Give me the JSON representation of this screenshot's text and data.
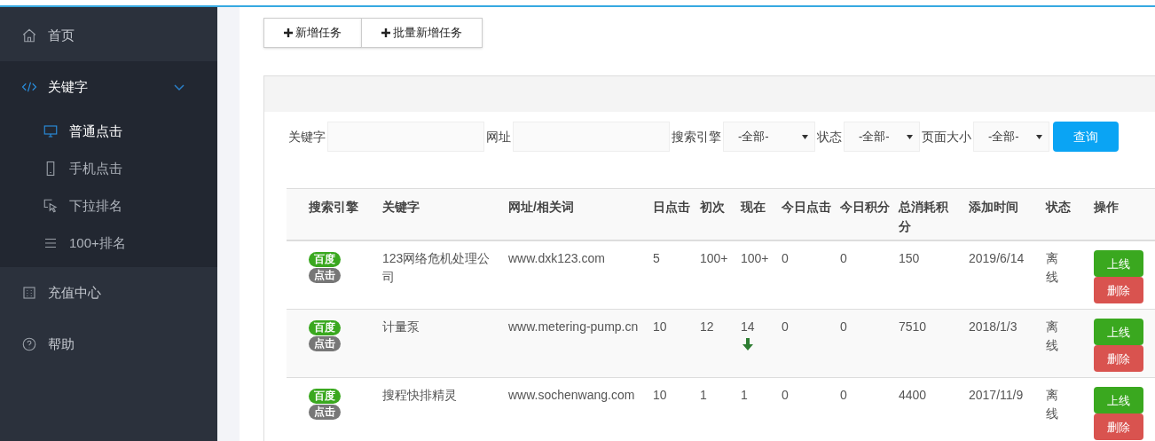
{
  "sidebar": {
    "items": [
      {
        "label": "首页",
        "selected": false,
        "expanded": false
      },
      {
        "label": "关键字",
        "selected": false,
        "expanded": true,
        "children": [
          {
            "label": "普通点击",
            "selected": true
          },
          {
            "label": "手机点击",
            "selected": false
          },
          {
            "label": "下拉排名",
            "selected": false
          },
          {
            "label": "100+排名",
            "selected": false
          }
        ]
      },
      {
        "label": "充值中心",
        "selected": false,
        "expanded": false
      },
      {
        "label": "帮助",
        "selected": false,
        "expanded": false
      }
    ]
  },
  "toolbar": {
    "buttons": [
      "新增任务",
      "批量新增任务"
    ]
  },
  "filters": {
    "fields": [
      {
        "kind": "input",
        "label": "关键字"
      },
      {
        "kind": "input",
        "label": "网址"
      },
      {
        "kind": "select",
        "label": "搜索引擎",
        "value": "-全部-"
      },
      {
        "kind": "select",
        "label": "状态",
        "value": "-全部-"
      },
      {
        "kind": "select",
        "label": "页面大小",
        "value": "-全部-"
      }
    ],
    "submit": "查询"
  },
  "table": {
    "columns": [
      "搜索引擎",
      "关键字",
      "网址/相关词",
      "日点击",
      "初次",
      "现在",
      "今日点击",
      "今日积分",
      "总消耗积分",
      "添加时间",
      "状态",
      "操作"
    ],
    "rows": [
      {
        "engine": "百度",
        "type": "点击",
        "keyword": "123网络危机处理公司",
        "url": "www.dxk123.com",
        "daily": "5",
        "first": "100+",
        "now": "100+",
        "falling": false,
        "today_clicks": "0",
        "today_points": "0",
        "total_points": "150",
        "added": "2019/6/14",
        "status": "离线",
        "actions": [
          "上线",
          "删除"
        ]
      },
      {
        "engine": "百度",
        "type": "点击",
        "keyword": "计量泵",
        "url": "www.metering-pump.cn",
        "daily": "10",
        "first": "12",
        "now": "14",
        "falling": true,
        "today_clicks": "0",
        "today_points": "0",
        "total_points": "7510",
        "added": "2018/1/3",
        "status": "离线",
        "actions": [
          "上线",
          "删除"
        ]
      },
      {
        "engine": "百度",
        "type": "点击",
        "keyword": "搜程快排精灵",
        "url": "www.sochenwang.com",
        "daily": "10",
        "first": "1",
        "now": "1",
        "falling": false,
        "today_clicks": "0",
        "today_points": "0",
        "total_points": "4400",
        "added": "2017/11/9",
        "status": "离线",
        "actions": [
          "上线",
          "删除"
        ]
      }
    ]
  }
}
